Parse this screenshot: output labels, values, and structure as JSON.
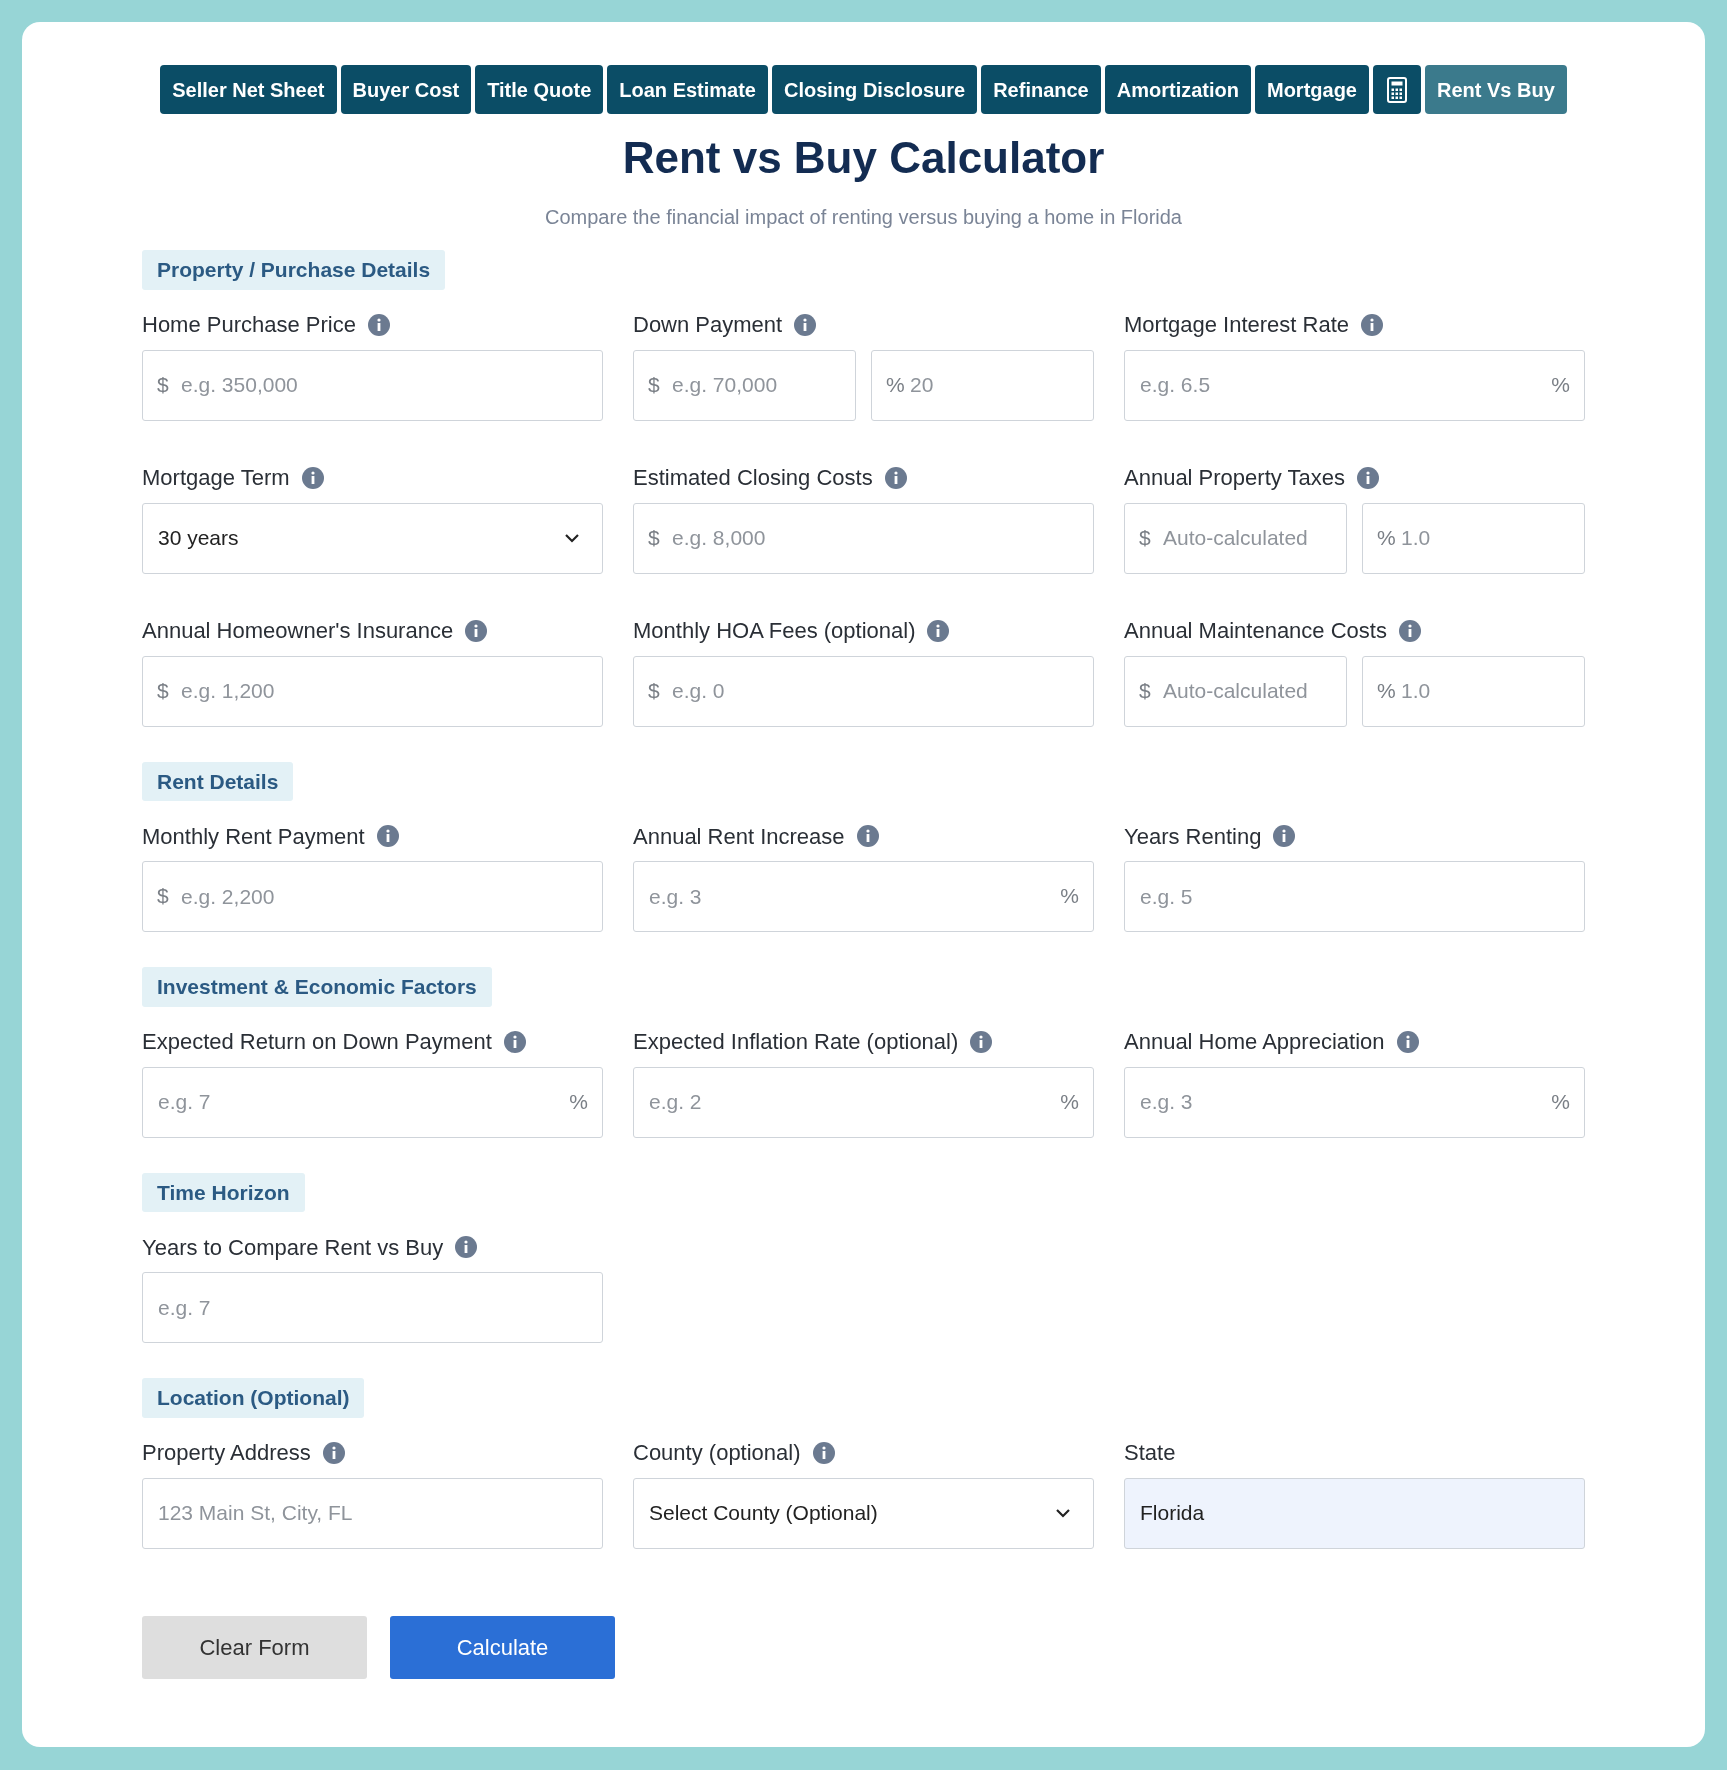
{
  "nav_tabs": [
    {
      "kind": "text",
      "label": "Seller Net Sheet",
      "selected": false
    },
    {
      "kind": "text",
      "label": "Buyer Cost",
      "selected": false
    },
    {
      "kind": "text",
      "label": "Title Quote",
      "selected": false
    },
    {
      "kind": "text",
      "label": "Loan Estimate",
      "selected": false
    },
    {
      "kind": "text",
      "label": "Closing Disclosure",
      "selected": false
    },
    {
      "kind": "text",
      "label": "Refinance",
      "selected": false
    },
    {
      "kind": "text",
      "label": "Amortization",
      "selected": false
    },
    {
      "kind": "text",
      "label": "Mortgage",
      "selected": false
    },
    {
      "kind": "icon",
      "selected": false
    },
    {
      "kind": "text",
      "label": "Rent Vs Buy",
      "selected": true
    }
  ],
  "title": "Rent vs Buy Calculator",
  "subtitle": "Compare the financial impact of renting versus buying a home in Florida",
  "sections": [
    {
      "heading": "Property / Purchase Details",
      "fields": [
        {
          "label": "Home Purchase Price",
          "info": true,
          "kind": "single",
          "prefix": "$",
          "placeholder": "e.g. 350,000"
        },
        {
          "label": "Down Payment",
          "info": true,
          "kind": "split",
          "parts": [
            {
              "prefix": "$",
              "placeholder": "e.g. 70,000"
            },
            {
              "prefix": "%",
              "placeholder": "20"
            }
          ]
        },
        {
          "label": "Mortgage Interest Rate",
          "info": true,
          "kind": "single",
          "suffix": "%",
          "placeholder": "e.g. 6.5"
        },
        {
          "label": "Mortgage Term",
          "info": true,
          "kind": "select",
          "value": "30 years"
        },
        {
          "label": "Estimated Closing Costs",
          "info": true,
          "kind": "single",
          "prefix": "$",
          "placeholder": "e.g. 8,000"
        },
        {
          "label": "Annual Property Taxes",
          "info": true,
          "kind": "split",
          "parts": [
            {
              "prefix": "$",
              "placeholder": "Auto-calculated"
            },
            {
              "prefix": "%",
              "placeholder": "1.0"
            }
          ]
        },
        {
          "label": "Annual Homeowner's Insurance",
          "info": true,
          "kind": "single",
          "prefix": "$",
          "placeholder": "e.g. 1,200"
        },
        {
          "label": "Monthly HOA Fees (optional)",
          "info": true,
          "kind": "single",
          "prefix": "$",
          "placeholder": "e.g. 0"
        },
        {
          "label": "Annual Maintenance Costs",
          "info": true,
          "kind": "split",
          "parts": [
            {
              "prefix": "$",
              "placeholder": "Auto-calculated"
            },
            {
              "prefix": "%",
              "placeholder": "1.0"
            }
          ]
        }
      ]
    },
    {
      "heading": "Rent Details",
      "fields": [
        {
          "label": "Monthly Rent Payment",
          "info": true,
          "kind": "single",
          "prefix": "$",
          "placeholder": "e.g. 2,200"
        },
        {
          "label": "Annual Rent Increase",
          "info": true,
          "kind": "single",
          "suffix": "%",
          "placeholder": "e.g. 3"
        },
        {
          "label": "Years Renting",
          "info": true,
          "kind": "single",
          "placeholder": "e.g. 5"
        }
      ]
    },
    {
      "heading": "Investment & Economic Factors",
      "fields": [
        {
          "label": "Expected Return on Down Payment",
          "info": true,
          "kind": "single",
          "suffix": "%",
          "placeholder": "e.g. 7"
        },
        {
          "label": "Expected Inflation Rate (optional)",
          "info": true,
          "kind": "single",
          "suffix": "%",
          "placeholder": "e.g. 2"
        },
        {
          "label": "Annual Home Appreciation",
          "info": true,
          "kind": "single",
          "suffix": "%",
          "placeholder": "e.g. 3"
        }
      ]
    },
    {
      "heading": "Time Horizon",
      "fields": [
        {
          "label": "Years to Compare Rent vs Buy",
          "info": true,
          "kind": "single",
          "placeholder": "e.g. 7"
        }
      ]
    },
    {
      "heading": "Location (Optional)",
      "fields": [
        {
          "label": "Property Address",
          "info": true,
          "kind": "single",
          "placeholder": "123 Main St, City, FL"
        },
        {
          "label": "County (optional)",
          "info": true,
          "kind": "select",
          "value": "Select County (Optional)"
        },
        {
          "label": "State",
          "info": false,
          "kind": "readonly",
          "value": "Florida"
        }
      ]
    }
  ],
  "buttons": [
    {
      "kind": "secondary",
      "label": "Clear Form"
    },
    {
      "kind": "primary",
      "label": "Calculate"
    }
  ]
}
